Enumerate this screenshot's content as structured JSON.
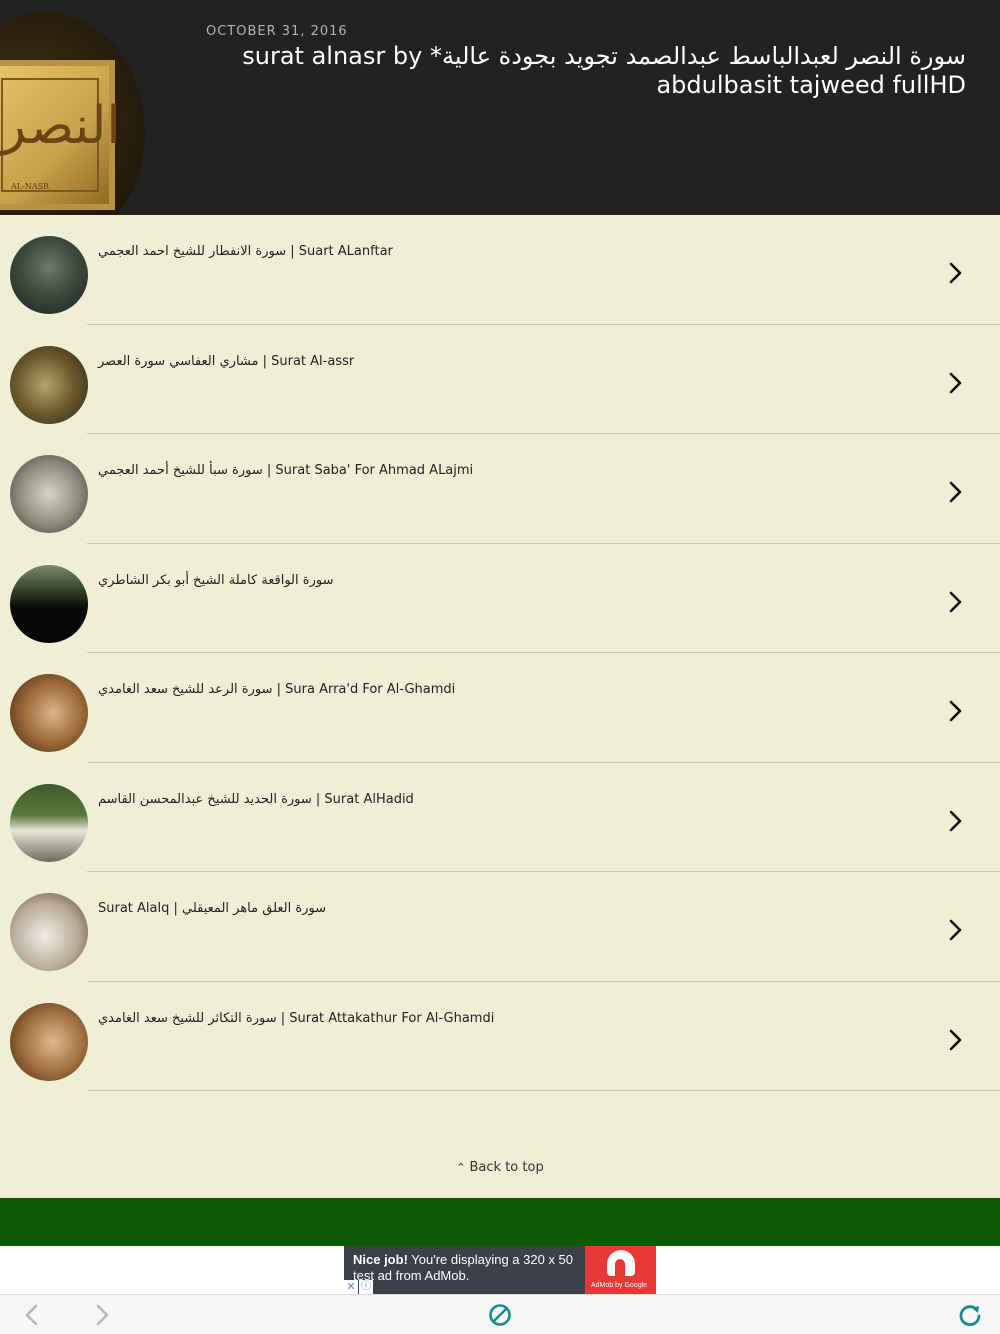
{
  "header": {
    "date": "OCTOBER 31, 2016",
    "title": "سورة النصر لعبدالباسط عبدالصمد تجويد بجودة عالية* surat alnasr by abdulbasit tajweed fullHD",
    "thumb_glyph": "النصر",
    "thumb_caption": "AL-NASR"
  },
  "list": {
    "items": [
      {
        "title": "سورة الانفطار للشيخ احمد العجمي | Suart ALanftar"
      },
      {
        "title": "مشاري العفاسي سورة العصر | Surat Al-assr"
      },
      {
        "title": "سورة سبأ للشيخ أحمد العجمي | Surat Saba' For Ahmad ALajmi"
      },
      {
        "title": "سورة الواقعة كاملة الشيخ أبو بكر الشاطري"
      },
      {
        "title": "سورة الرعد للشيخ سعد الغامدي | Sura Arra'd For Al-Ghamdi"
      },
      {
        "title": "سورة الحديد للشيخ عبدالمحسن القاسم | Surat AlHadid"
      },
      {
        "title": "Surat Alalq | سورة العلق ماهر المعيقلي"
      },
      {
        "title": "سورة التكاثر للشيخ سعد الغامدي | Surat Attakathur For Al-Ghamdi"
      }
    ]
  },
  "back_to_top": {
    "label": "Back to top"
  },
  "ad": {
    "bold": "Nice job!",
    "text": " You're displaying a 320 x 50 test ad from AdMob.",
    "brand": "AdMob by Google"
  },
  "icons": {
    "chevron": "chevron-right-icon",
    "back": "arrow-left-icon",
    "forward": "arrow-right-icon",
    "stop": "stop-icon",
    "reload": "reload-icon"
  },
  "colors": {
    "header_bg": "#222222",
    "page_bg": "#efefd6",
    "green_band": "#0d5a06",
    "ad_red": "#e53935",
    "toolbar_accent": "#1b8a8a"
  }
}
